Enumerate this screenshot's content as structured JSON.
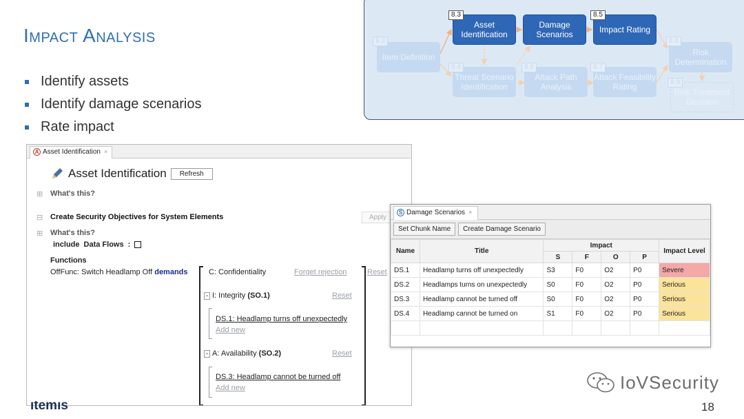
{
  "slide": {
    "title": "Impact Analysis",
    "bullets": [
      "Identify assets",
      "Identify damage scenarios",
      "Rate impact"
    ],
    "page_number": "18",
    "watermark": "IoVSecurity",
    "footer_logo": "itemis"
  },
  "diagram": {
    "nodes": [
      {
        "id": "9.3",
        "label": "Item Definition",
        "state": "faded"
      },
      {
        "id": "8.3",
        "label": "Asset Identification",
        "state": "active"
      },
      {
        "id": "",
        "label": "Damage Scenarios",
        "state": "active"
      },
      {
        "id": "8.5",
        "label": "Impact Rating",
        "state": "active"
      },
      {
        "id": "8.4",
        "label": "Threat Scenario Identification",
        "state": "faded"
      },
      {
        "id": "8.6",
        "label": "Attack Path Analysis",
        "state": "faded"
      },
      {
        "id": "8.7",
        "label": "Attack Feasibility Rating",
        "state": "faded"
      },
      {
        "id": "8.8",
        "label": "Risk Determination",
        "state": "faded"
      },
      {
        "id": "8.9",
        "label": "Risk Treatment Decision",
        "state": "faded"
      }
    ],
    "colors": {
      "active": "#2f67b7",
      "faded": "#c5daf0",
      "background": "#dce9f5"
    }
  },
  "asset_window": {
    "tab_label": "Asset Identification",
    "tab_icon_letter": "A",
    "title": "Asset Identification",
    "refresh_label": "Refresh",
    "whats_this_1": "What's this?",
    "section_title": "Create Security Objectives for System Elements",
    "apply_label": "Apply",
    "whats_this_2": "What's this?",
    "include_label": "include",
    "data_flows_label": "Data Flows",
    "colon": ":",
    "functions_label": "Functions",
    "function_text": "OffFunc: Switch Headlamp Off",
    "demands_label": "demands",
    "objectives": [
      {
        "label": "C: Confidentiality",
        "action": "Forget rejection",
        "reset": "Reset"
      },
      {
        "label": "I: Integrity",
        "so": "(SO.1)",
        "action": "Reset",
        "scenario": "DS.1: Headlamp turns off unexpectedly",
        "add_new": "Add new"
      },
      {
        "label": "A: Availability",
        "so": "(SO.2)",
        "action": "Reset",
        "scenario": "DS.3: Headlamp cannot be turned off",
        "add_new": "Add new"
      }
    ],
    "minus": "-"
  },
  "ds_window": {
    "tab_label": "Damage Scenarios",
    "tab_icon_letter": "S",
    "buttons": {
      "set_chunk_name": "Set Chunk Name",
      "create_damage_scenario": "Create Damage Scenario"
    },
    "headers": {
      "name": "Name",
      "title": "Title",
      "impact": "Impact",
      "s": "S",
      "f": "F",
      "o": "O",
      "p": "P",
      "impact_level": "Impact Level"
    },
    "rows": [
      {
        "name": "DS.1",
        "title": "Headlamp turns off unexpectedly",
        "s": "S3",
        "f": "F0",
        "o": "O2",
        "p": "P0",
        "level": "Severe"
      },
      {
        "name": "DS.2",
        "title": "Headlamps turns on unexpectedly",
        "s": "S0",
        "f": "F0",
        "o": "O2",
        "p": "P0",
        "level": "Serious"
      },
      {
        "name": "DS.3",
        "title": "Headlamp cannot be turned off",
        "s": "S0",
        "f": "F0",
        "o": "O2",
        "p": "P0",
        "level": "Serious"
      },
      {
        "name": "DS.4",
        "title": "Headlamp cannot be turned on",
        "s": "S1",
        "f": "F0",
        "o": "O2",
        "p": "P0",
        "level": "Serious"
      }
    ],
    "level_colors": {
      "Severe": "#f4a8a8",
      "Serious": "#fbe39a"
    }
  }
}
